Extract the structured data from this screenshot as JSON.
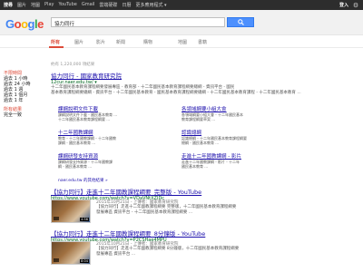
{
  "topbar": {
    "items": [
      "搜尋",
      "圖片",
      "地圖",
      "Play",
      "YouTube",
      "Gmail",
      "雲端硬碟",
      "日曆",
      "更多應用程式 ▾"
    ],
    "login": "登入",
    "login_label": "登入"
  },
  "logo": "Google",
  "search": {
    "value": "協力同行"
  },
  "tabs": [
    "所有",
    "圖片",
    "影片",
    "新聞",
    "購物",
    "地圖",
    "書籍"
  ],
  "tabs_labels": {
    "all": "所有",
    "images": "圖片",
    "videos": "影片",
    "news": "新聞",
    "shopping": "購物",
    "maps": "地圖",
    "books": "書籍"
  },
  "stats": "約有 1,220,000 項結果",
  "sidebar": {
    "time_title": "不限時間",
    "time_items": [
      "過去 1 小時",
      "過去 24 小時",
      "過去 1 週",
      "過去 1 個月",
      "過去 1 年"
    ],
    "results_title": "所有結果",
    "results_items": [
      "完全一致"
    ]
  },
  "result1": {
    "title": "協力同行 - 國家教育研究院",
    "url": "12cur.naer.edu.tw/ ▾",
    "snippet1": "十二年國民基本教育課程綱要發展專區 - 教育部 - 十二年國民基本教育課程綱要總綱 - 資訊平台 - 國民",
    "snippet2": "基本教育課程綱要總綱 - 資訊平台 - 十二年國民基本教育 - 國民基本教育課程綱要總綱 - 十二年國民基本教育課程 - 十二年國民基本教育 ..."
  },
  "sitelinks": [
    {
      "title": "課綱說明文件下載",
      "s1": "課綱說明文件下載 - 國民基本教育 ...",
      "s2": "十二年國民基本教育課程綱要 ..."
    },
    {
      "title": "各領域綱要小組大會",
      "s1": "各領域綱要小組大會 - 十二年國民基本",
      "s2": "教育課程綱要草案 ..."
    },
    {
      "title": "十二年國教課綱",
      "s1": "教育 - 十二年國教課綱 - 十二年國教",
      "s2": "課綱 - 國民基本教育 ..."
    },
    {
      "title": "認識總綱",
      "s1": "認識總綱 - 十二年國民基本教育課程綱要",
      "s2": "總綱 - 國民基本教育 ..."
    },
    {
      "title": "課綱研發支持資源",
      "s1": "課綱研發支持資源 - 十二年國教課",
      "s2": "綱 - 國民基本教育 ..."
    },
    {
      "title": "走進十二年國教課綱 - 影片",
      "s1": "走進十二年國教課綱 - 影片 - 十二年",
      "s2": "國民基本教育 ..."
    }
  ],
  "more_link": "naer.edu.tw 的其他結果 »",
  "videos": [
    {
      "title": "【協力同行】走進十二年國教課程綱要_完整版 - YouTube",
      "url": "https://www.youtube.com/watch?v=VDaVNtXZIDc",
      "date": "2015年10月21日 - 上傳者：國家教育研究院",
      "snip1": "【協力同行】走進十二年國教課程綱要 完整版，十二年國民基本教育課程綱要",
      "snip2": "發展專區 資訊平台 - 十二年國民基本教育課程綱要 ...",
      "duration": "4:56"
    },
    {
      "title": "【協力同行】走進十二年國教課程綱要_8分鐘版 - YouTube",
      "url": "https://www.youtube.com/watch?v=P2CSHae4MPU",
      "date": "2015年10月21日 - 上傳者：國家教育研究院",
      "snip1": "【協力同行】走進十二年國教課程綱要 8分鐘版，十二年國民基本教育課程綱要",
      "snip2": "發展專區 資訊平台 ...",
      "duration": "8:04"
    }
  ]
}
